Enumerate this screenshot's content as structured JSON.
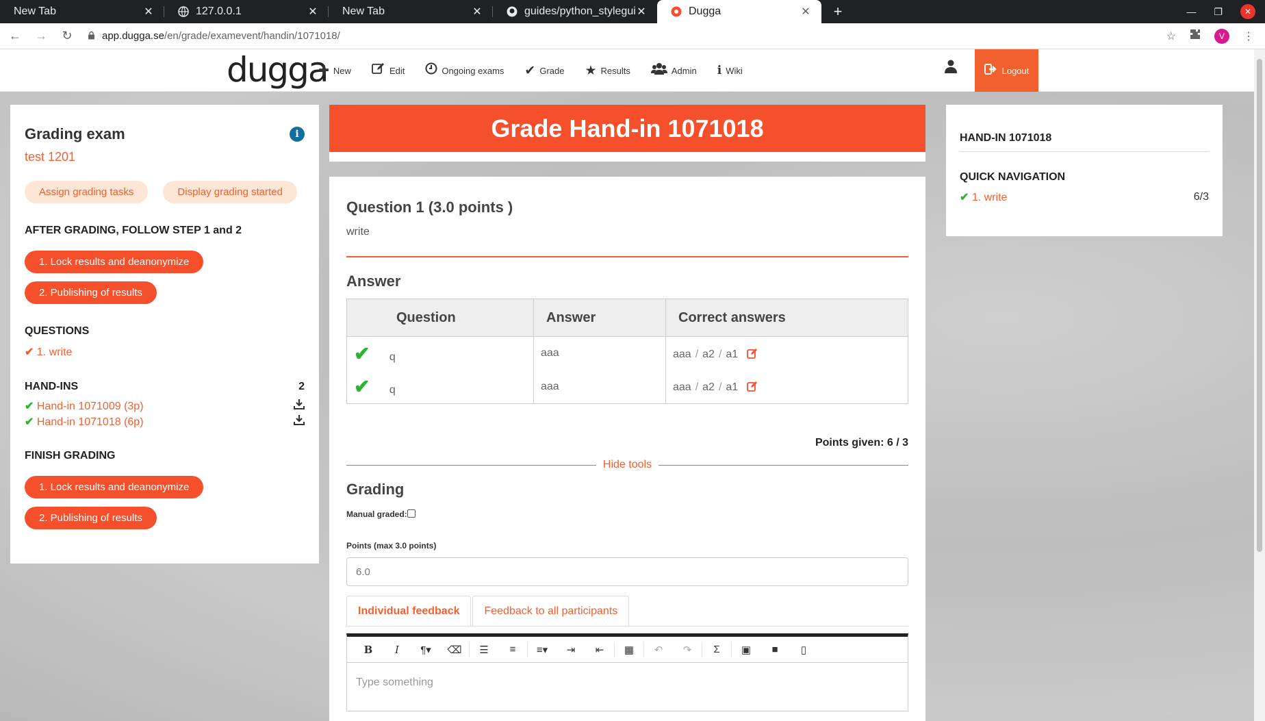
{
  "browser": {
    "tabs": [
      {
        "title": "New Tab",
        "active": false
      },
      {
        "title": "127.0.0.1",
        "active": false
      },
      {
        "title": "New Tab",
        "active": false
      },
      {
        "title": "guides/python_styleguide",
        "active": false
      },
      {
        "title": "Dugga",
        "active": true
      }
    ],
    "url_host": "app.dugga.se",
    "url_path": "/en/grade/examevent/handin/1071018/",
    "profile_initial": "V"
  },
  "nav": {
    "logo": "dugga",
    "items": [
      {
        "label": "New",
        "icon": "plus-icon"
      },
      {
        "label": "Edit",
        "icon": "edit-icon"
      },
      {
        "label": "Ongoing exams",
        "icon": "clock-icon"
      },
      {
        "label": "Grade",
        "icon": "check-icon"
      },
      {
        "label": "Results",
        "icon": "star-icon"
      },
      {
        "label": "Admin",
        "icon": "users-icon"
      },
      {
        "label": "Wiki",
        "icon": "info-icon"
      }
    ],
    "logout": "Logout"
  },
  "left": {
    "title": "Grading exam",
    "subtitle": "test 1201",
    "assign_btn": "Assign grading tasks",
    "display_btn": "Display grading started",
    "after_heading": "AFTER GRADING, FOLLOW STEP 1 and 2",
    "lock_btn": "1. Lock results and deanonymize",
    "publish_btn": "2. Publishing of results",
    "questions_heading": "QUESTIONS",
    "question_num": "1.",
    "question_label": "write",
    "handins_heading": "HAND-INS",
    "handins_count": "2",
    "handins": [
      {
        "label": "Hand-in 1071009 (3p)"
      },
      {
        "label": "Hand-in 1071018 (6p)"
      }
    ],
    "finish_heading": "FINISH GRADING",
    "finish_lock_btn": "1. Lock results and deanonymize",
    "finish_publish_btn": "2. Publishing of results"
  },
  "main": {
    "banner": "Grade Hand-in 1071018",
    "question_title": "Question 1 (3.0 points )",
    "question_text": "write",
    "answer_heading": "Answer",
    "table": {
      "headers": [
        "Question",
        "Answer",
        "Correct answers"
      ],
      "rows": [
        {
          "question": "q",
          "answer": "aaa",
          "correct": [
            "aaa",
            "a2",
            "a1"
          ]
        },
        {
          "question": "q",
          "answer": "aaa",
          "correct": [
            "aaa",
            "a2",
            "a1"
          ]
        }
      ],
      "separator": "/"
    },
    "points_given": "Points given: 6 / 3",
    "hide_tools": "Hide tools",
    "grading_heading": "Grading",
    "manual_graded_label": "Manual graded:",
    "points_label": "Points (max 3.0 points)",
    "points_value": "6.0",
    "tab_individual": "Individual feedback",
    "tab_all": "Feedback to all participants",
    "editor_placeholder": "Type something"
  },
  "right": {
    "handin_heading": "HAND-IN 1071018",
    "quicknav_heading": "QUICK NAVIGATION",
    "item_num": "1.",
    "item_label": "write",
    "item_score": "6/3"
  },
  "colors": {
    "accent": "#f5502b",
    "success": "#2bb52f",
    "info": "#136f9d"
  }
}
